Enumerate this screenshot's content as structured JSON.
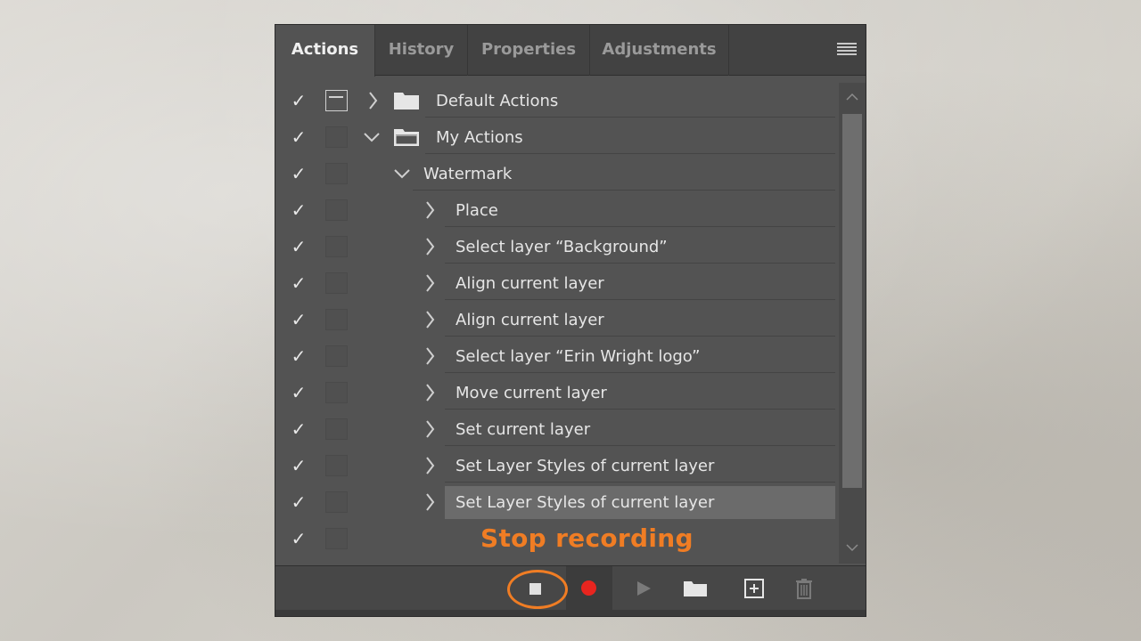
{
  "tabs": [
    {
      "label": "Actions",
      "active": true
    },
    {
      "label": "History",
      "active": false
    },
    {
      "label": "Properties",
      "active": false
    },
    {
      "label": "Adjustments",
      "active": false
    }
  ],
  "rows": [
    {
      "name": "Default Actions",
      "type": "set",
      "expanded": false,
      "dialog_on": true,
      "checked": true
    },
    {
      "name": "My Actions",
      "type": "set",
      "expanded": true,
      "dialog_on": false,
      "checked": true
    },
    {
      "name": "Watermark",
      "type": "action",
      "expanded": true,
      "dialog_on": false,
      "checked": true
    },
    {
      "name": "Place",
      "type": "step",
      "checked": true
    },
    {
      "name": "Select layer “Background”",
      "type": "step",
      "checked": true
    },
    {
      "name": "Align current layer",
      "type": "step",
      "checked": true
    },
    {
      "name": "Align current layer",
      "type": "step",
      "checked": true
    },
    {
      "name": "Select layer “Erin Wright logo”",
      "type": "step",
      "checked": true
    },
    {
      "name": "Move current layer",
      "type": "step",
      "checked": true
    },
    {
      "name": "Set current layer",
      "type": "step",
      "checked": true
    },
    {
      "name": "Set Layer Styles of current layer",
      "type": "step",
      "checked": true
    },
    {
      "name": "Set Layer Styles of current layer",
      "type": "step",
      "checked": true,
      "selected": true
    }
  ],
  "annotation": "Stop recording",
  "bottom_buttons": [
    "stop-recording",
    "begin-recording",
    "play-selection",
    "create-new-set",
    "create-new-action",
    "delete"
  ],
  "colors": {
    "accent": "#f07d24",
    "record": "#e8251f",
    "panel": "#535353"
  }
}
